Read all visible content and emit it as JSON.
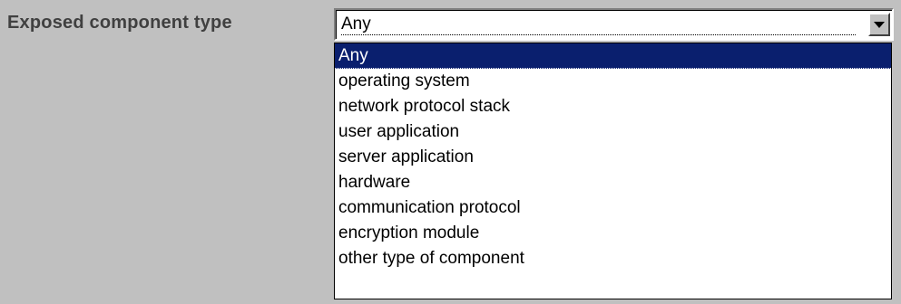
{
  "field": {
    "label": "Exposed component type"
  },
  "select": {
    "value": "Any",
    "icon": "chevron-down-icon"
  },
  "options": [
    {
      "label": "Any",
      "selected": true
    },
    {
      "label": "operating system",
      "selected": false
    },
    {
      "label": "network protocol stack",
      "selected": false
    },
    {
      "label": "user application",
      "selected": false
    },
    {
      "label": "server application",
      "selected": false
    },
    {
      "label": "hardware",
      "selected": false
    },
    {
      "label": "communication protocol",
      "selected": false
    },
    {
      "label": "encryption module",
      "selected": false
    },
    {
      "label": "other type of component",
      "selected": false
    }
  ],
  "colors": {
    "background": "#c0c0c0",
    "highlight": "#0a1f6e",
    "label_text": "#404040"
  }
}
